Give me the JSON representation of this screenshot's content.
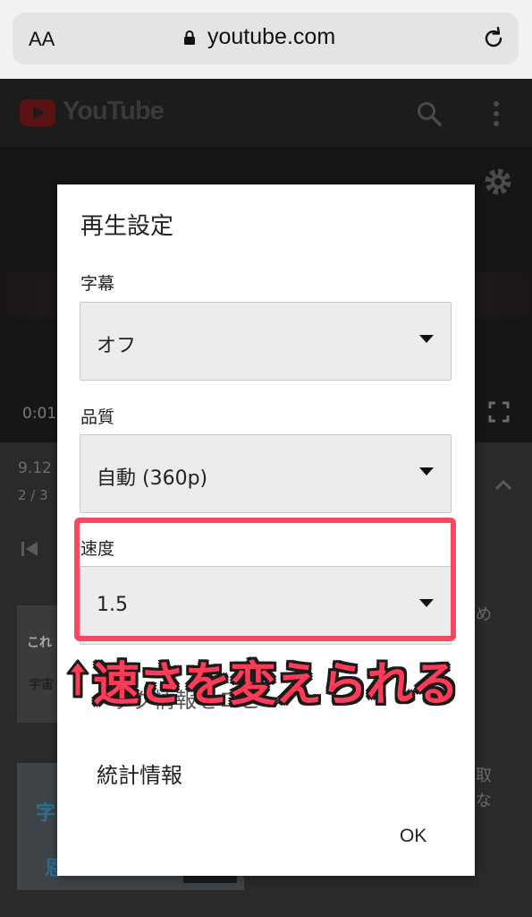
{
  "browser": {
    "text_size_label": "AA",
    "url": "youtube.com"
  },
  "youtube": {
    "logo_text": "YouTube",
    "time_text": "0:01",
    "info_line1": "9.12",
    "info_line2": "2 / 3",
    "thumb1_text_a": "これ",
    "thumb1_text_b": "宇宙",
    "thumb2_text_a": "字",
    "thumb2_text_b": "恩",
    "side_text1": "め",
    "side_text2": "取",
    "side_text3": "な"
  },
  "dialog": {
    "title": "再生設定",
    "fields": [
      {
        "label": "字幕",
        "value": "オフ"
      },
      {
        "label": "品質",
        "value": "自動 (360p)"
      },
      {
        "label": "速度",
        "value": "1.5"
      }
    ],
    "obscured_item": "ッグ情報をコピ",
    "stats_label": "統計情報",
    "ok_label": "OK"
  },
  "annotation": {
    "text": "速さを変えられる",
    "color": "#ff3b58"
  },
  "colors": {
    "highlight": "#fb4861",
    "dialog_bg": "#ffffff",
    "select_bg": "#ececec"
  }
}
